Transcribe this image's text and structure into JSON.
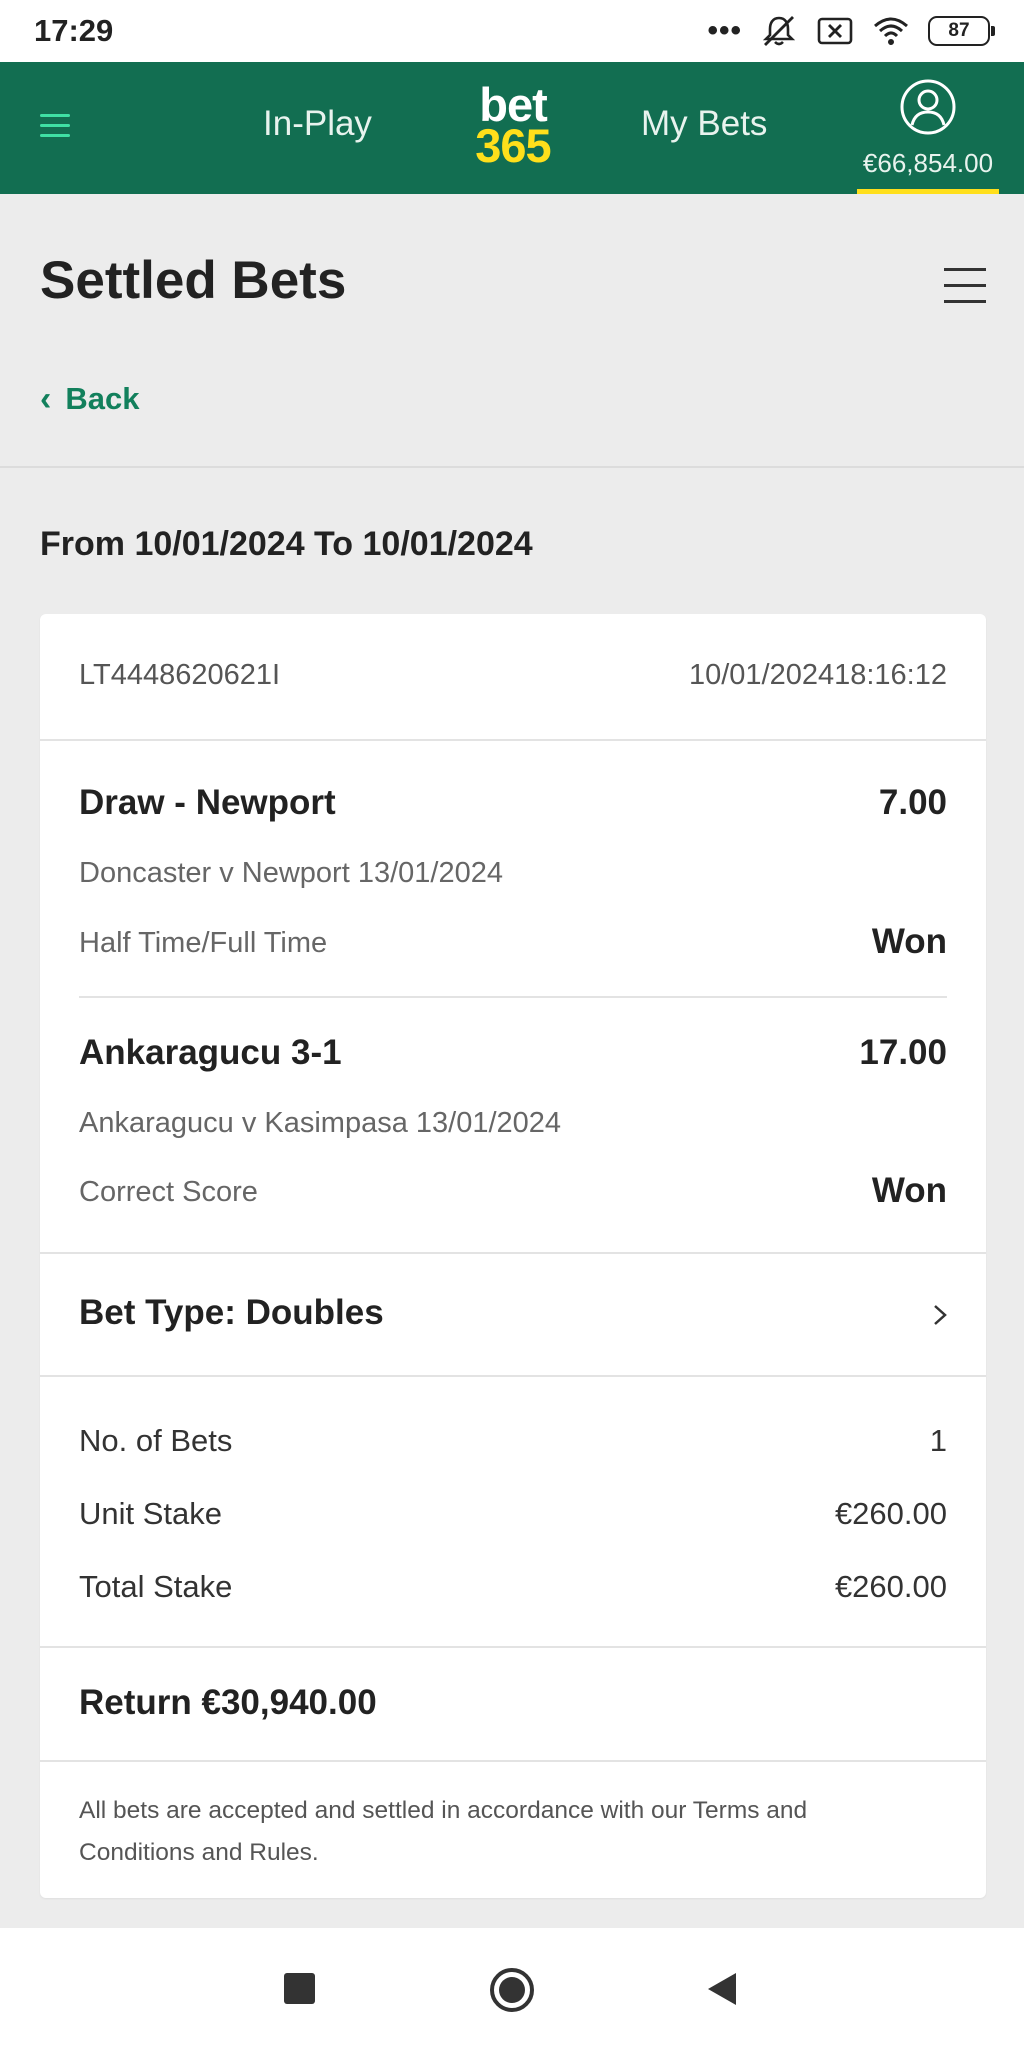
{
  "status_bar": {
    "time": "17:29",
    "dots": "•••",
    "battery": "87",
    "icons": [
      "mute-icon",
      "no-sim-icon",
      "wifi-icon",
      "battery-icon"
    ]
  },
  "header": {
    "menu_icon": "hamburger-icon",
    "in_play": "In-Play",
    "logo_line1": "bet",
    "logo_line2": "365",
    "my_bets": "My Bets",
    "balance": "€66,854.00",
    "colors": {
      "brand_green": "#126e51",
      "brand_yellow": "#ffdf1b",
      "accent_green": "#3fe0a4"
    }
  },
  "page": {
    "title": "Settled Bets",
    "back_label": "Back",
    "date_range": "From 10/01/2024 To 10/01/2024"
  },
  "bet": {
    "reference": "LT4448620621I",
    "datetime": "10/01/202418:16:12",
    "selections": [
      {
        "name": "Draw - Newport",
        "odds": "7.00",
        "event": "Doncaster v Newport 13/01/2024",
        "market": "Half Time/Full Time",
        "result": "Won"
      },
      {
        "name": "Ankaragucu 3-1",
        "odds": "17.00",
        "event": "Ankaragucu v Kasimpasa 13/01/2024",
        "market": "Correct Score",
        "result": "Won"
      }
    ],
    "bet_type": "Bet Type: Doubles",
    "summary": {
      "no_of_bets_label": "No. of Bets",
      "no_of_bets": "1",
      "unit_stake_label": "Unit Stake",
      "unit_stake": "€260.00",
      "total_stake_label": "Total Stake",
      "total_stake": "€260.00"
    },
    "return": "Return €30,940.00",
    "terms": "All bets are accepted and settled in accordance with our Terms and Conditions and Rules."
  },
  "android_nav": [
    "recents-square-icon",
    "home-circle-icon",
    "back-triangle-icon"
  ]
}
